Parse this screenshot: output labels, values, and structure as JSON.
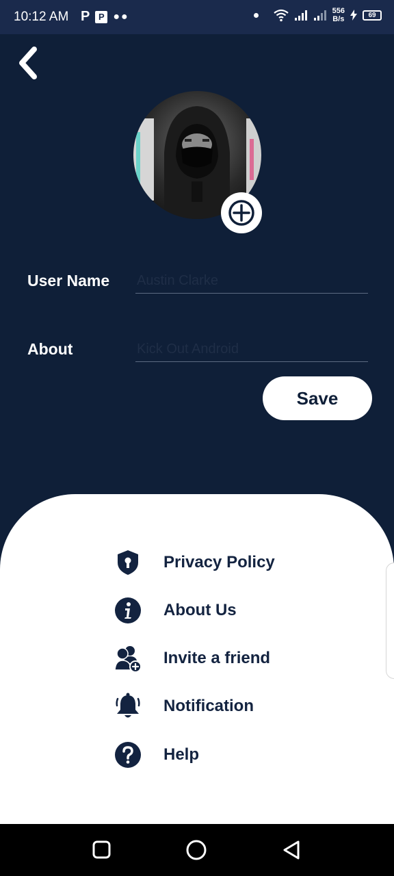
{
  "status_bar": {
    "time": "10:12 AM",
    "left_icons": [
      "p-icon",
      "pi-icon",
      "more-dots-icon"
    ],
    "speed_value": "556",
    "speed_unit": "B/s",
    "battery": "69"
  },
  "header": {
    "back_icon": "chevron-left-icon"
  },
  "profile": {
    "add_photo_icon": "plus-icon",
    "username_label": "User Name",
    "username_placeholder": "Austin Clarke",
    "about_label": "About",
    "about_placeholder": "Kick Out Android",
    "save_label": "Save"
  },
  "menu": {
    "items": [
      {
        "label": "Privacy Policy",
        "icon": "shield-lock-icon"
      },
      {
        "label": "About Us",
        "icon": "info-icon"
      },
      {
        "label": "Invite a friend",
        "icon": "add-user-icon"
      },
      {
        "label": "Notification",
        "icon": "bell-icon"
      },
      {
        "label": "Help",
        "icon": "question-icon"
      }
    ]
  },
  "colors": {
    "background": "#0f1f38",
    "status_bar": "#1a2a4c",
    "sheet": "#ffffff",
    "menu_text": "#132340"
  }
}
